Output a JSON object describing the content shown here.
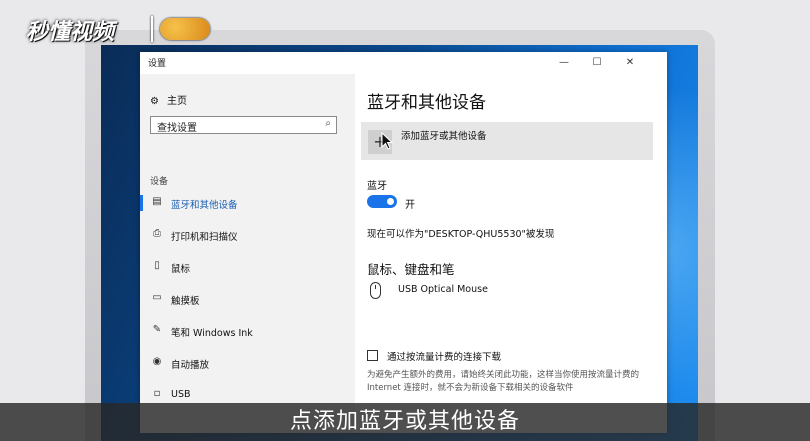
{
  "watermark": {
    "brand": "秒懂视频"
  },
  "window": {
    "title": "设置",
    "controls": {
      "minimize": "—",
      "maximize": "☐",
      "close": "✕"
    }
  },
  "sidebar": {
    "home": "主页",
    "search_value": "查找设置",
    "section": "设备",
    "items": [
      {
        "label": "蓝牙和其他设备",
        "icon": "bluetooth-devices-icon",
        "glyph": "▤"
      },
      {
        "label": "打印机和扫描仪",
        "icon": "printer-icon",
        "glyph": "⎙"
      },
      {
        "label": "鼠标",
        "icon": "mouse-icon",
        "glyph": "▯"
      },
      {
        "label": "触摸板",
        "icon": "touchpad-icon",
        "glyph": "▭"
      },
      {
        "label": "笔和 Windows Ink",
        "icon": "pen-icon",
        "glyph": "✎"
      },
      {
        "label": "自动播放",
        "icon": "autoplay-icon",
        "glyph": "◉"
      },
      {
        "label": "USB",
        "icon": "usb-icon",
        "glyph": "▫"
      }
    ]
  },
  "main": {
    "title": "蓝牙和其他设备",
    "add_device": "添加蓝牙或其他设备",
    "bluetooth_label": "蓝牙",
    "toggle_state": "开",
    "discoverable": "现在可以作为\"DESKTOP-QHU5530\"被发现",
    "mouse_section": "鼠标、键盘和笔",
    "device_name": "USB Optical Mouse",
    "metered_label": "通过按流量计费的连接下载",
    "metered_desc": "为避免产生额外的费用，请始终关闭此功能，这样当你使用按流量计费的 Internet 连接时，就不会为新设备下载相关的设备软件"
  },
  "subtitle": "点添加蓝牙或其他设备",
  "colors": {
    "accent": "#1a73e8",
    "desktop": "#0b4a8f"
  }
}
